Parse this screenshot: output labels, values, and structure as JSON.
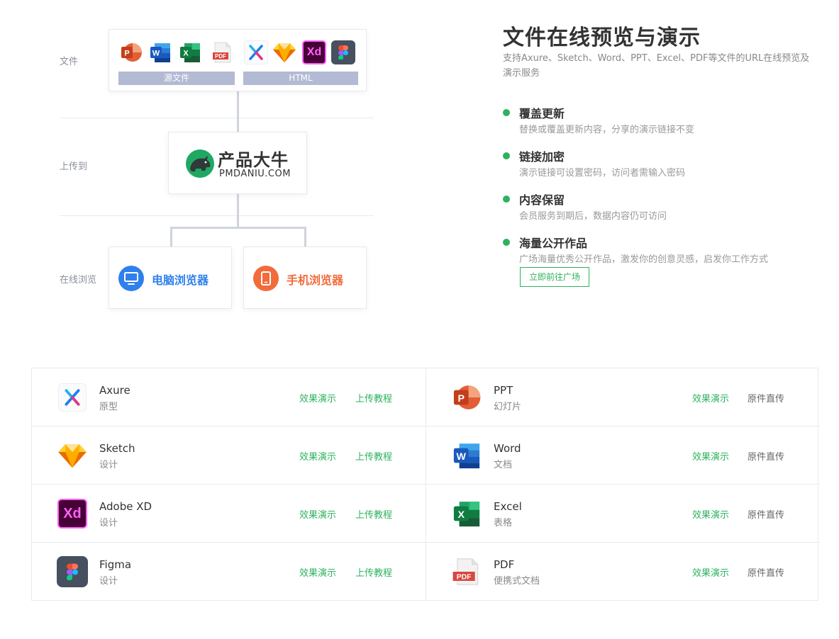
{
  "diagram": {
    "labels": {
      "files": "文件",
      "upload": "上传到",
      "browse": "在线浏览"
    },
    "file_groups": {
      "source": "源文件",
      "html": "HTML"
    },
    "brand": {
      "name": "产品大牛",
      "domain": "PMDANIU.COM"
    },
    "browsers": {
      "desktop": {
        "label": "电脑浏览器",
        "icon": "monitor-icon"
      },
      "mobile": {
        "label": "手机浏览器",
        "icon": "phone-icon"
      }
    },
    "file_icons": [
      "ppt-icon",
      "word-icon",
      "excel-icon",
      "pdf-icon",
      "axure-icon",
      "sketch-icon",
      "xd-icon",
      "figma-icon"
    ]
  },
  "hero": {
    "title": "文件在线预览与演示",
    "description": "支持Axure、Sketch、Word、PPT、Excel、PDF等文件的URL在线预览及演示服务"
  },
  "features": [
    {
      "title": "覆盖更新",
      "desc": "替换或覆盖更新内容，分享的演示链接不变"
    },
    {
      "title": "链接加密",
      "desc": "演示链接可设置密码，访问者需输入密码"
    },
    {
      "title": "内容保留",
      "desc": "会员服务到期后，数据内容仍可访问"
    },
    {
      "title": "海量公开作品",
      "desc": "广场海量优秀公开作品，激发你的创意灵感，启发你工作方式"
    }
  ],
  "goto_square": "立即前往广场",
  "colors": {
    "accent": "#2db25e",
    "desktop": "#2f80ed",
    "mobile": "#f26b3a",
    "bar": "#b3bad3"
  },
  "table": {
    "left": [
      {
        "name": "Axure",
        "sub": "原型",
        "link1": "效果演示",
        "link2": "上传教程",
        "icon": "axure-icon"
      },
      {
        "name": "Sketch",
        "sub": "设计",
        "link1": "效果演示",
        "link2": "上传教程",
        "icon": "sketch-icon"
      },
      {
        "name": "Adobe XD",
        "sub": "设计",
        "link1": "效果演示",
        "link2": "上传教程",
        "icon": "xd-icon"
      },
      {
        "name": "Figma",
        "sub": "设计",
        "link1": "效果演示",
        "link2": "上传教程",
        "icon": "figma-icon"
      }
    ],
    "right": [
      {
        "name": "PPT",
        "sub": "幻灯片",
        "link1": "效果演示",
        "link2": "原件直传",
        "icon": "ppt-icon"
      },
      {
        "name": "Word",
        "sub": "文档",
        "link1": "效果演示",
        "link2": "原件直传",
        "icon": "word-icon"
      },
      {
        "name": "Excel",
        "sub": "表格",
        "link1": "效果演示",
        "link2": "原件直传",
        "icon": "excel-icon"
      },
      {
        "name": "PDF",
        "sub": "便携式文档",
        "link1": "效果演示",
        "link2": "原件直传",
        "icon": "pdf-icon"
      }
    ]
  }
}
